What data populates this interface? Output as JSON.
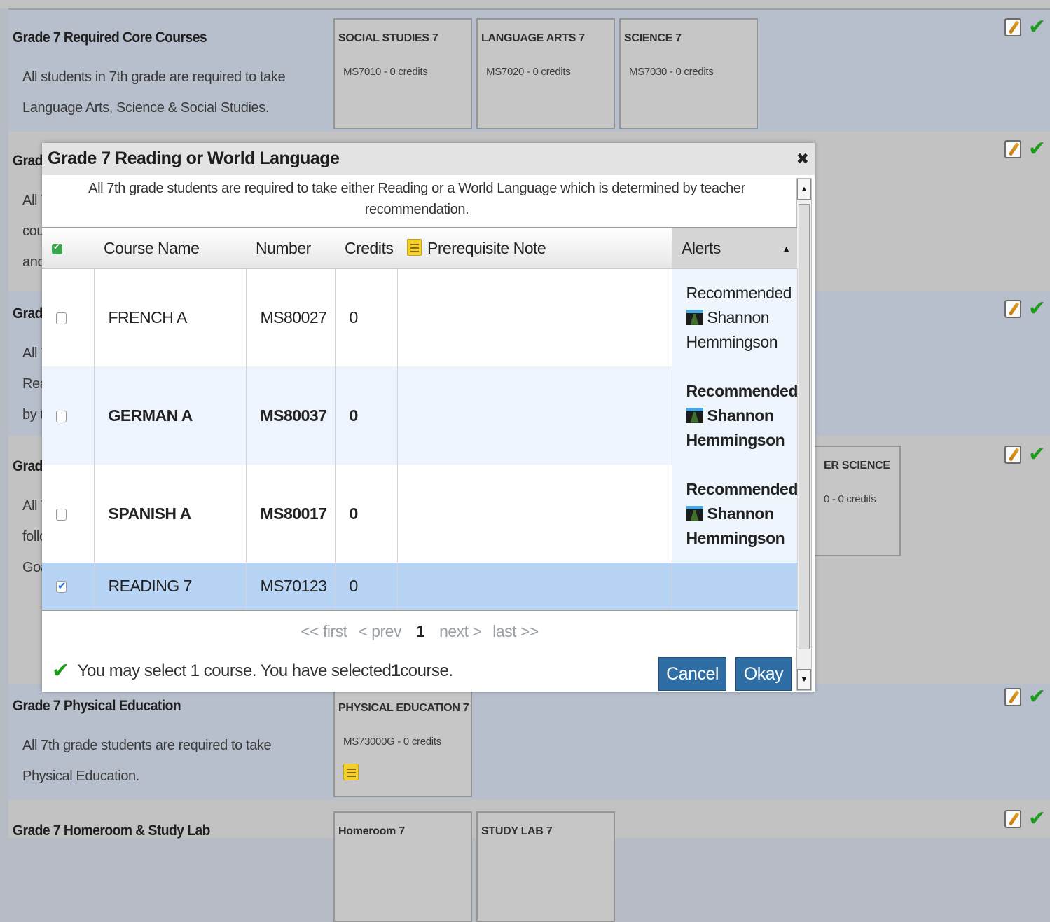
{
  "rows": {
    "core": {
      "title": "Grade 7 Required Core Courses",
      "description": "All students in 7th grade are required to take Language Arts, Science & Social Studies.",
      "courses": [
        {
          "name": "SOCIAL STUDIES 7",
          "number": "MS7010 - 0 credits"
        },
        {
          "name": "LANGUAGE ARTS 7",
          "number": "MS7020 - 0 credits"
        },
        {
          "name": "SCIENCE 7",
          "number": "MS7030 - 0 credits"
        }
      ]
    },
    "reading_partial": {
      "title": "Grad",
      "desc_lines": [
        "All 7",
        "cou",
        "and"
      ]
    },
    "third_partial": {
      "title": "Grad",
      "desc_lines": [
        "All 7",
        "Rea",
        "by t"
      ]
    },
    "fourth_partial": {
      "title": "Grad",
      "desc_lines": [
        "All 7",
        "follo",
        "Goa"
      ],
      "course_name": "ER SCIENCE",
      "course_number": "0 - 0 credits"
    },
    "pe": {
      "title": "Grade 7 Physical Education",
      "description": "All 7th grade students are required to take Physical Education.",
      "course_name": "PHYSICAL EDUCATION 7",
      "course_number": "MS73000G - 0 credits",
      "note_icon": "note-icon"
    },
    "homeroom": {
      "title": "Grade 7 Homeroom & Study Lab",
      "courses": [
        {
          "name": "Homeroom 7"
        },
        {
          "name": "STUDY LAB 7"
        }
      ]
    }
  },
  "icons": {
    "edit": "edit-pencil-icon",
    "complete": "checkmark-icon",
    "close": "close-x-icon",
    "alert": "road-icon"
  },
  "colors": {
    "accent": "#2f6ea5",
    "success": "#1d9b1d",
    "selected_row": "#b7d4f5"
  },
  "modal": {
    "title": "Grade 7 Reading or World Language",
    "close_label": "✖",
    "description": "All 7th grade students are required to take either Reading or a World Language which is determined by teacher recommendation.",
    "columns": {
      "course_name": "Course Name",
      "number": "Number",
      "credits": "Credits",
      "prereq": "Prerequisite Note",
      "alerts": "Alerts",
      "alerts_sort": "▲"
    },
    "courses": [
      {
        "name": "FRENCH A",
        "number": "MS80027",
        "credits": "0",
        "selected": false,
        "alert": "Recommended",
        "alert_person_first": "Shannon",
        "alert_person_last": "Hemmingson"
      },
      {
        "name": "GERMAN A",
        "number": "MS80037",
        "credits": "0",
        "selected": false,
        "alert": "Recommended",
        "alert_person_first": "Shannon",
        "alert_person_last": "Hemmingson"
      },
      {
        "name": "SPANISH A",
        "number": "MS80017",
        "credits": "0",
        "selected": false,
        "alert": "Recommended",
        "alert_person_first": "Shannon",
        "alert_person_last": "Hemmingson"
      },
      {
        "name": "READING 7",
        "number": "MS70123",
        "credits": "0",
        "selected": true,
        "alert": "",
        "alert_person_first": "",
        "alert_person_last": ""
      }
    ],
    "pager": {
      "first": "<< first",
      "prev": "< prev",
      "current": "1",
      "next": "next >",
      "last": "last >>"
    },
    "status": {
      "prefix": "You may select 1 course. You have selected ",
      "count": "1",
      "suffix": " course."
    },
    "buttons": {
      "cancel": "Cancel",
      "okay": "Okay"
    }
  }
}
